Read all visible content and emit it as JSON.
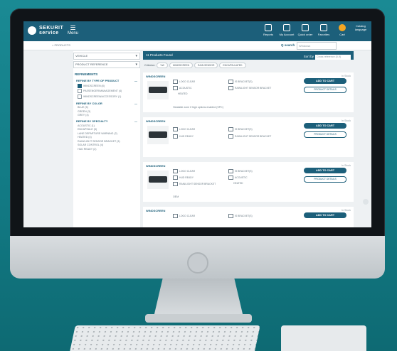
{
  "brand": {
    "line1": "SEKURIT",
    "line2": "service"
  },
  "header": {
    "menu_label": "Menu",
    "actions": [
      {
        "label": "Reports"
      },
      {
        "label": "My Account"
      },
      {
        "label": "Quick order"
      },
      {
        "label": "Favorites"
      },
      {
        "label": "Cart"
      }
    ],
    "language": "Catalog language"
  },
  "subbar": {
    "breadcrumb": "> PRODUCTS",
    "search_label": "Q search",
    "search_placeholder": "Windows"
  },
  "sidebar": {
    "filters": [
      "VEHICLE",
      "PRODUCT REFERENCE"
    ],
    "refinements_title": "REFINEMENTS",
    "groups": [
      {
        "title": "REFINE BY TYPE OF PRODUCT",
        "options": [
          {
            "label": "WINDSCREEN (8)",
            "checked": true
          },
          {
            "label": "PASSENGER/MANAGEMENT (4)",
            "checked": false
          },
          {
            "label": "WINDSCREEN/ACCESSORY (1)",
            "checked": false
          }
        ]
      },
      {
        "title": "REFINE BY COLOR",
        "options": [
          {
            "label": "BLUE (5)",
            "checked": false
          },
          {
            "label": "GREEN (3)",
            "checked": false
          },
          {
            "label": "GREY (4)",
            "checked": false
          }
        ]
      },
      {
        "title": "REFINE BY SPECIALTY",
        "options": [
          {
            "label": "ACOUSTIC (1)",
            "checked": false
          },
          {
            "label": "ENCAPSULE (5)",
            "checked": false
          },
          {
            "label": "LANE DEPARTURE WARNING (2)",
            "checked": false
          },
          {
            "label": "HEATED (4)",
            "checked": false
          },
          {
            "label": "RAIN/LIGHT SENSOR BRACKET (3)",
            "checked": false
          },
          {
            "label": "SOLAR CONTROL (4)",
            "checked": false
          },
          {
            "label": "HUD READY (2)",
            "checked": false
          }
        ]
      }
    ]
  },
  "results": {
    "count_label": "11 Products Found",
    "sort_label": "Sort by",
    "sort_value": "Cross reference (0-9)",
    "criteria_label": "Criterion:",
    "chips": [
      "VW",
      "WINDSCREEN",
      "RAIN SENSOR",
      "ENCAPSULATED"
    ]
  },
  "cards": [
    {
      "title": "WINDSCREEN",
      "instock": "In Stock",
      "specs": [
        "LOGO CLEAR",
        "IS BRACKET(S)",
        "ACOUSTIC",
        "RAIN/LIGHT SENSOR BRACKET",
        "HEATED"
      ],
      "note": "Heatable zone if high options enabled (SPC)",
      "add": "ADD TO CART",
      "details": "PRODUCT DETAILS"
    },
    {
      "title": "WINDSCREEN",
      "instock": "In Stock",
      "specs": [
        "LOGO CLEAR",
        "IS BRACKET(S)",
        "HUD READY",
        "RAIN/LIGHT SENSOR BRACKET"
      ],
      "note": "",
      "add": "ADD TO CART",
      "details": "PRODUCT DETAILS"
    },
    {
      "title": "WINDSCREEN",
      "instock": "In Stock",
      "specs": [
        "LOGO CLEAR",
        "IS BRACKET(S)",
        "HUD READY",
        "ACOUSTIC",
        "RAIN/LIGHT SENSOR BRACKET",
        "HEATED"
      ],
      "note": "OEM",
      "add": "ADD TO CART",
      "details": "PRODUCT DETAILS"
    },
    {
      "title": "WINDSCREEN",
      "instock": "In Stock",
      "specs": [
        "LOGO CLEAR",
        "IS BRACKET(S)"
      ],
      "note": "",
      "add": "ADD TO CART",
      "details": "PRODUCT DETAILS"
    }
  ]
}
